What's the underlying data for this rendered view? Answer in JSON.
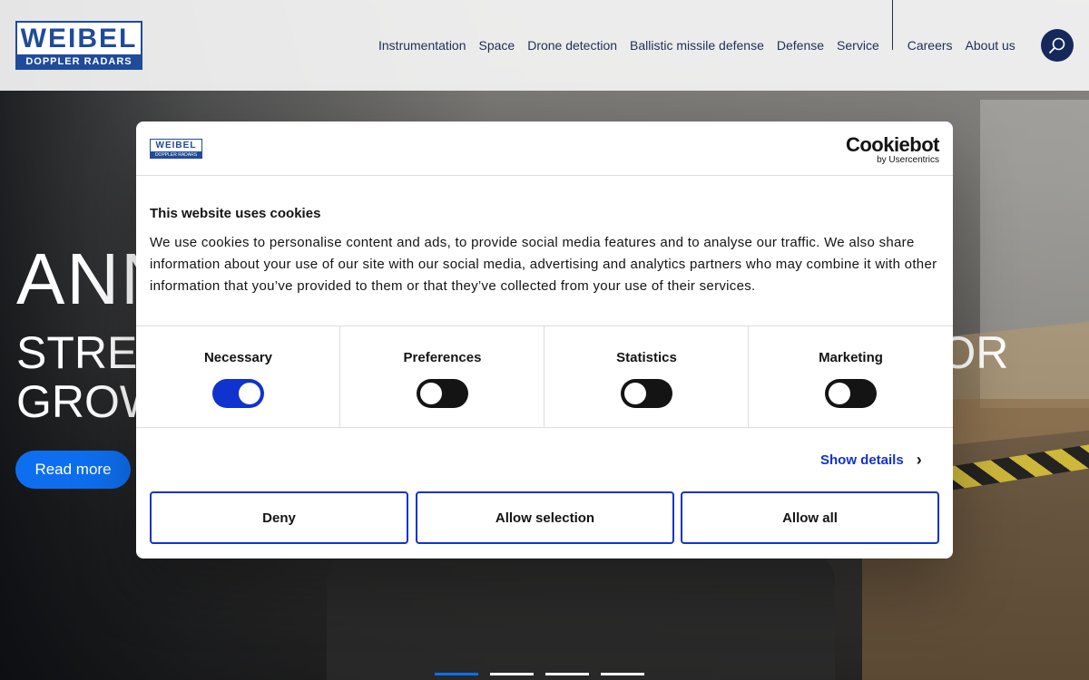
{
  "header": {
    "logo": {
      "line1": "WEIBEL",
      "line2": "DOPPLER RADARS"
    },
    "nav": [
      "Instrumentation",
      "Space",
      "Drone detection",
      "Ballistic missile defense",
      "Defense",
      "Service"
    ],
    "nav_secondary": [
      "Careers",
      "About us"
    ],
    "search_icon": "search-icon"
  },
  "hero": {
    "title": "ANN",
    "subtitle_line1_left": "STRE",
    "subtitle_line1_right": "OR",
    "subtitle_line2": "GROW",
    "read_more": "Read more",
    "slides": 4,
    "active_slide": 1
  },
  "cookie_dialog": {
    "logo": {
      "line1": "WEIBEL",
      "line2": "DOPPLER RADARS"
    },
    "brand": "Cookiebot",
    "brand_sub": "by Usercentrics",
    "title": "This website uses cookies",
    "body": "We use cookies to personalise content and ads, to provide social media features and to analyse our traffic. We also share information about your use of our site with our social media, advertising and analytics partners who may combine it with other information that you’ve provided to them or that they’ve collected from your use of their services.",
    "categories": [
      {
        "label": "Necessary",
        "on": true
      },
      {
        "label": "Preferences",
        "on": false
      },
      {
        "label": "Statistics",
        "on": false
      },
      {
        "label": "Marketing",
        "on": false
      }
    ],
    "show_details": "Show details",
    "buttons": {
      "deny": "Deny",
      "allow_selection": "Allow selection",
      "allow_all": "Allow all"
    },
    "colors": {
      "accent": "#1032cf",
      "brand_blue": "#1f4b9a",
      "cta_blue": "#0d6ff0"
    }
  }
}
